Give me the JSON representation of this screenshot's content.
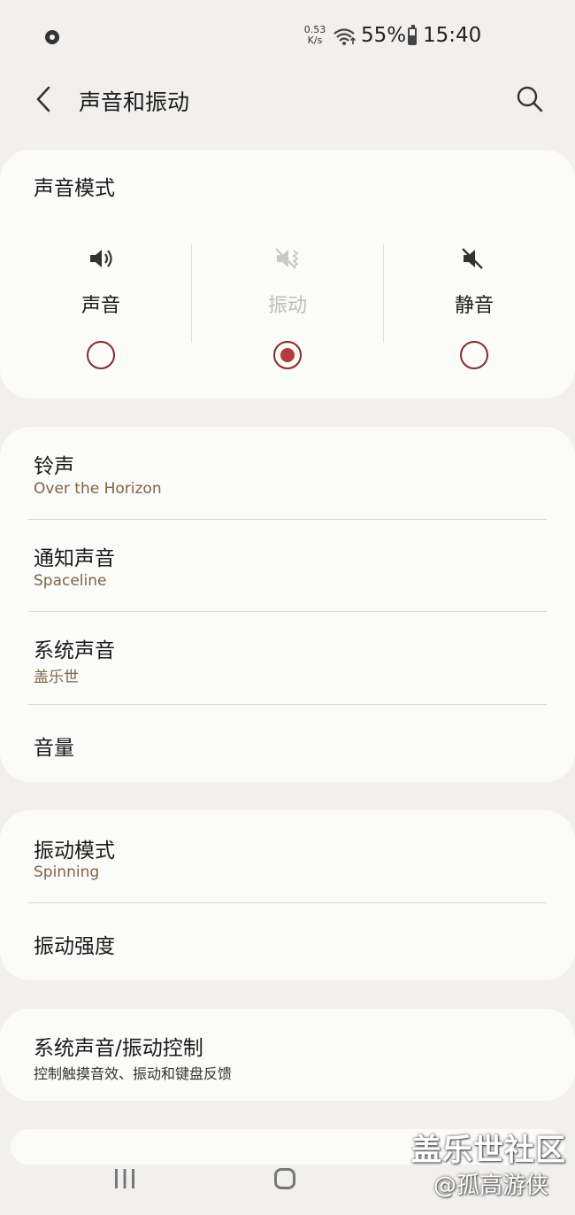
{
  "status_bar": {
    "net_speed_value": "0.53",
    "net_speed_unit": "K/s",
    "battery": "55%",
    "time": "15:40"
  },
  "header": {
    "title": "声音和振动"
  },
  "sound_mode": {
    "title": "声音模式",
    "options": [
      {
        "label": "声音",
        "icon": "speaker-icon",
        "selected": false
      },
      {
        "label": "振动",
        "icon": "vibrate-icon",
        "selected": true
      },
      {
        "label": "静音",
        "icon": "mute-icon",
        "selected": false
      }
    ]
  },
  "tones": [
    {
      "title": "铃声",
      "subtitle": "Over the Horizon"
    },
    {
      "title": "通知声音",
      "subtitle": "Spaceline"
    },
    {
      "title": "系统声音",
      "subtitle": "盖乐世"
    },
    {
      "title": "音量"
    }
  ],
  "vibration": [
    {
      "title": "振动模式",
      "subtitle": "Spinning"
    },
    {
      "title": "振动强度"
    }
  ],
  "system": {
    "title": "系统声音/振动控制",
    "subtitle": "控制触摸音效、振动和键盘反馈"
  },
  "watermark": {
    "line1": "盖乐世社区",
    "line2": "@孤高游侠"
  },
  "colors": {
    "accent": "#b53a3a",
    "subtitle": "#7e6543",
    "background": "#f1f0ee",
    "card": "#fbfbfa"
  }
}
